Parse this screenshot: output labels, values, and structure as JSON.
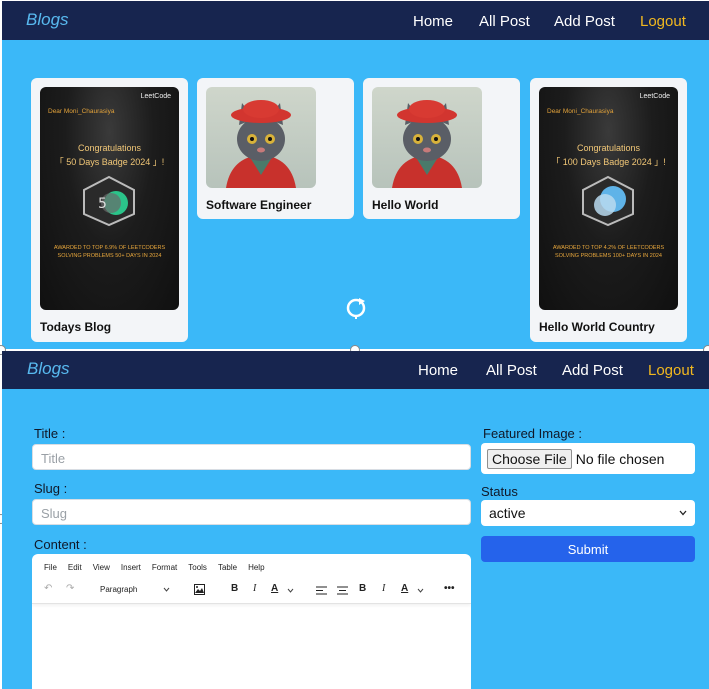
{
  "top_screen": {
    "nav": {
      "brand": "Blogs",
      "links": [
        "Home",
        "All Post",
        "Add Post"
      ],
      "logout": "Logout"
    },
    "posts": [
      {
        "title": "Todays Blog",
        "image": {
          "kind": "leetcode-badge",
          "logo": "LeetCode",
          "greeting": "Dear Moni_Chaurasiya",
          "congrats": "Congratulations",
          "badge": "「 50 Days Badge 2024 」!",
          "award_line1": "AWARDED TO TOP 6.9% OF LEETCODERS",
          "award_line2": "SOLVING PROBLEMS 50+ DAYS IN 2024"
        }
      },
      {
        "title": "Software Engineer",
        "image": {
          "kind": "cat-photo"
        }
      },
      {
        "title": "Hello World",
        "image": {
          "kind": "cat-photo"
        }
      },
      {
        "title": "Hello World Country",
        "image": {
          "kind": "leetcode-badge",
          "logo": "LeetCode",
          "greeting": "Dear Moni_Chaurasiya",
          "congrats": "Congratulations",
          "badge": "「 100 Days Badge 2024 」!",
          "award_line1": "AWARDED TO TOP 4.2% OF LEETCODERS",
          "award_line2": "SOLVING PROBLEMS 100+ DAYS IN 2024"
        }
      }
    ]
  },
  "bottom_screen": {
    "nav": {
      "brand": "Blogs",
      "links": [
        "Home",
        "All Post",
        "Add Post"
      ],
      "logout": "Logout"
    },
    "form": {
      "title_label": "Title :",
      "title_placeholder": "Title",
      "slug_label": "Slug :",
      "slug_placeholder": "Slug",
      "content_label": "Content :",
      "featured_label": "Featured Image :",
      "file_button": "Choose File",
      "file_status": "No file chosen",
      "status_label": "Status",
      "status_value": "active",
      "submit_label": "Submit"
    },
    "editor": {
      "menu": [
        "File",
        "Edit",
        "View",
        "Insert",
        "Format",
        "Tools",
        "Table",
        "Help"
      ],
      "paragraph_select": "Paragraph"
    }
  },
  "colors": {
    "navbar": "#17254f",
    "panel": "#3bb8f8",
    "brand": "#58b9ef",
    "logout": "#f2b81f",
    "submit": "#2563eb"
  }
}
